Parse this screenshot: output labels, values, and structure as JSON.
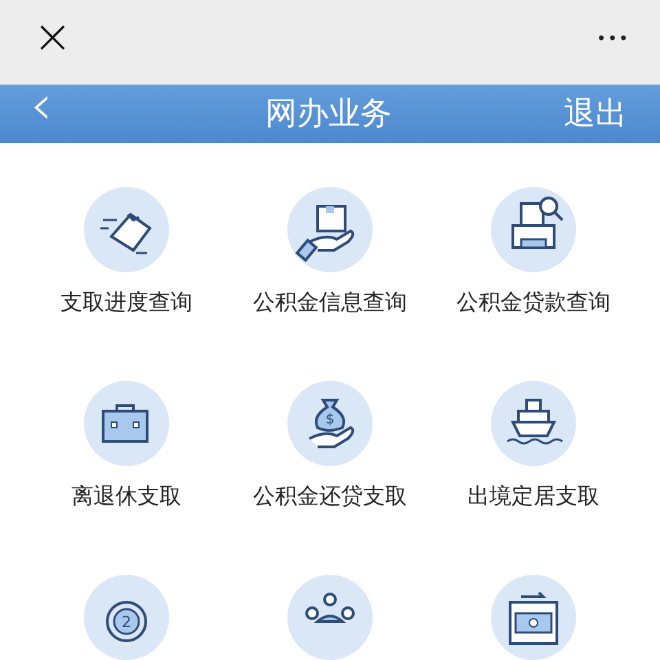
{
  "top_bar": {
    "close": "×",
    "more": "•••"
  },
  "header": {
    "back": "‹",
    "title": "网办业务",
    "action": "退出"
  },
  "services": [
    {
      "kind": "document",
      "label": "支取进度查询"
    },
    {
      "kind": "package",
      "label": "公积金信息查询"
    },
    {
      "kind": "printer",
      "label": "公积金贷款查询"
    },
    {
      "kind": "briefcase",
      "label": "离退休支取"
    },
    {
      "kind": "moneybag",
      "label": "公积金还贷支取",
      "glyph": "$"
    },
    {
      "kind": "ship",
      "label": "出境定居支取"
    },
    {
      "kind": "cycle",
      "glyph": "2"
    },
    {
      "kind": "meeting"
    },
    {
      "kind": "transfer"
    }
  ]
}
